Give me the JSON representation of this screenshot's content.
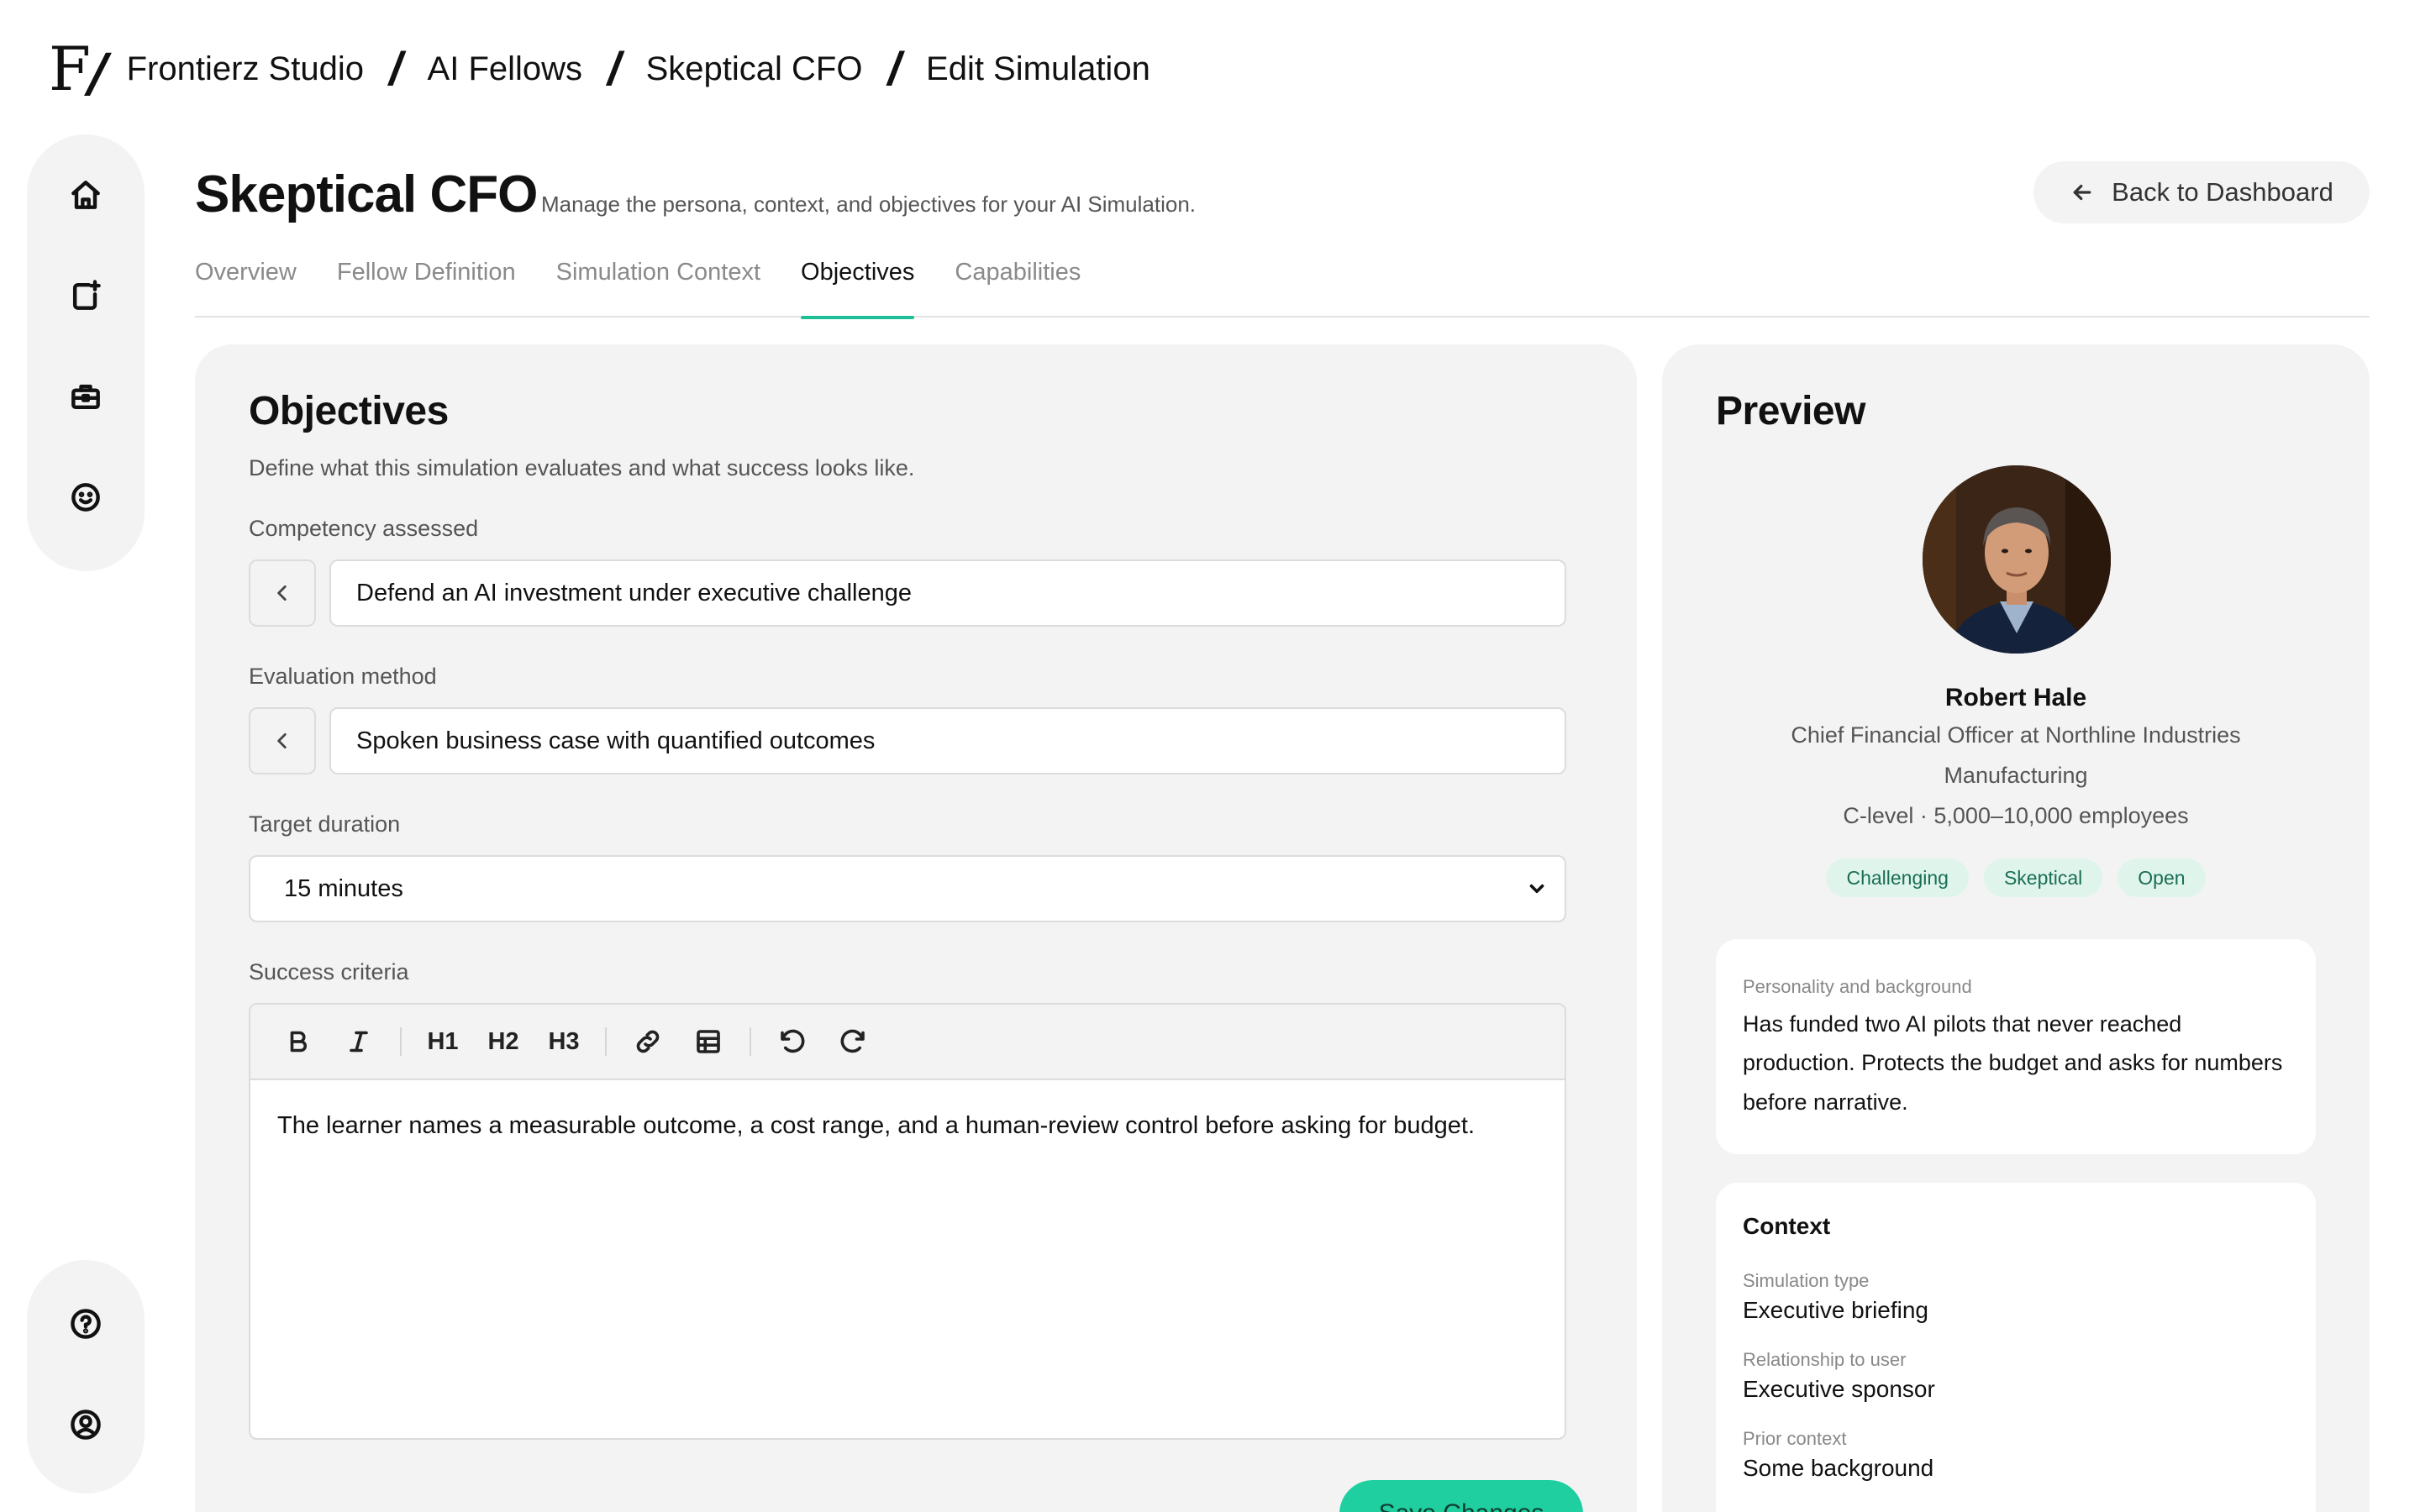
{
  "breadcrumb": {
    "logo": "F",
    "items": [
      "Frontierz Studio",
      "AI Fellows",
      "Skeptical CFO",
      "Edit Simulation"
    ]
  },
  "header": {
    "title": "Skeptical CFO",
    "subtitle": "Manage the persona, context, and objectives for your AI Simulation.",
    "back_label": "Back to Dashboard"
  },
  "tabs": [
    {
      "label": "Overview",
      "active": false
    },
    {
      "label": "Fellow Definition",
      "active": false
    },
    {
      "label": "Simulation Context",
      "active": false
    },
    {
      "label": "Objectives",
      "active": true
    },
    {
      "label": "Capabilities",
      "active": false
    }
  ],
  "objectives": {
    "title": "Objectives",
    "description": "Define what this simulation evaluates and what success looks like.",
    "competency_label": "Competency assessed",
    "competency_value": "Defend an AI investment under executive challenge",
    "evaluation_label": "Evaluation method",
    "evaluation_value": "Spoken business case with quantified outcomes",
    "duration_label": "Target duration",
    "duration_value": "15 minutes",
    "criteria_label": "Success criteria",
    "toolbar": {
      "h1": "H1",
      "h2": "H2",
      "h3": "H3"
    },
    "criteria_text": "The learner names a measurable outcome, a cost range, and a human-review control before asking for budget.",
    "save_label": "Save Changes"
  },
  "preview": {
    "title": "Preview",
    "name": "Robert Hale",
    "role": "Chief Financial Officer at Northline Industries",
    "industry": "Manufacturing",
    "level": "C-level · 5,000–10,000 employees",
    "tags": [
      "Challenging",
      "Skeptical",
      "Open"
    ],
    "background_label": "Personality and background",
    "background_text": "Has funded two AI pilots that never reached production. Protects the budget and asks for numbers before narrative.",
    "context_title": "Context",
    "context_items": [
      {
        "label": "Simulation type",
        "value": "Executive briefing"
      },
      {
        "label": "Relationship to user",
        "value": "Executive sponsor"
      },
      {
        "label": "Prior context",
        "value": "Some background"
      }
    ]
  },
  "colors": {
    "accent": "#1fbf95",
    "button": "#1fcf9f",
    "tag_bg": "#dff5ec",
    "panel": "#f3f3f4"
  }
}
